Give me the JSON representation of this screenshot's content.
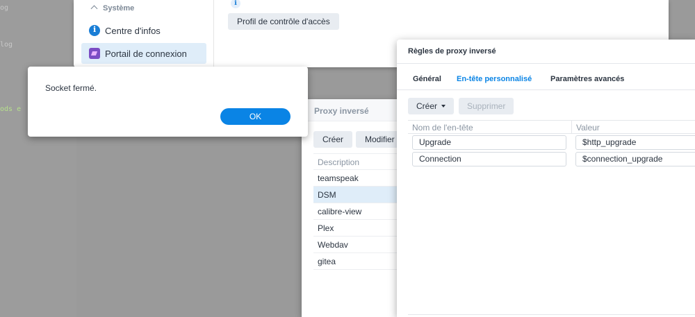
{
  "terminal": {
    "lines": [
      {
        "text": "og"
      },
      {
        "text": "log"
      },
      {
        "text": "ods  e"
      }
    ]
  },
  "control_panel": {
    "section_label": "Système",
    "items": [
      {
        "label": "Centre d'infos",
        "icon": "info-icon"
      },
      {
        "label": "Portail de connexion",
        "icon": "login-portal-icon",
        "active": true
      }
    ],
    "main": {
      "info_glyph": "i",
      "acl_button": "Profil de contrôle d'accès"
    }
  },
  "dialog": {
    "message": "Socket fermé.",
    "ok_label": "OK"
  },
  "proxy_window": {
    "title": "Proxy inversé",
    "create_label": "Créer",
    "modify_label": "Modifier",
    "column_header": "Description",
    "rows": [
      "teamspeak",
      "DSM",
      "calibre-view",
      "Plex",
      "Webdav",
      "gitea"
    ],
    "selected_row": "DSM"
  },
  "rules_window": {
    "title": "Règles de proxy inversé",
    "tabs": [
      {
        "label": "Général",
        "active": false
      },
      {
        "label": "En-tête personnalisé",
        "active": true
      },
      {
        "label": "Paramètres avancés",
        "active": false
      }
    ],
    "create_label": "Créer",
    "delete_label": "Supprimer",
    "columns": [
      "Nom de l'en-tête",
      "Valeur"
    ],
    "headers": [
      {
        "name": "Upgrade",
        "value": "$http_upgrade"
      },
      {
        "name": "Connection",
        "value": "$connection_upgrade"
      }
    ]
  },
  "colors": {
    "accent": "#0a84e5",
    "selection": "#dfedf9",
    "desktop": "#9a9a9a"
  }
}
